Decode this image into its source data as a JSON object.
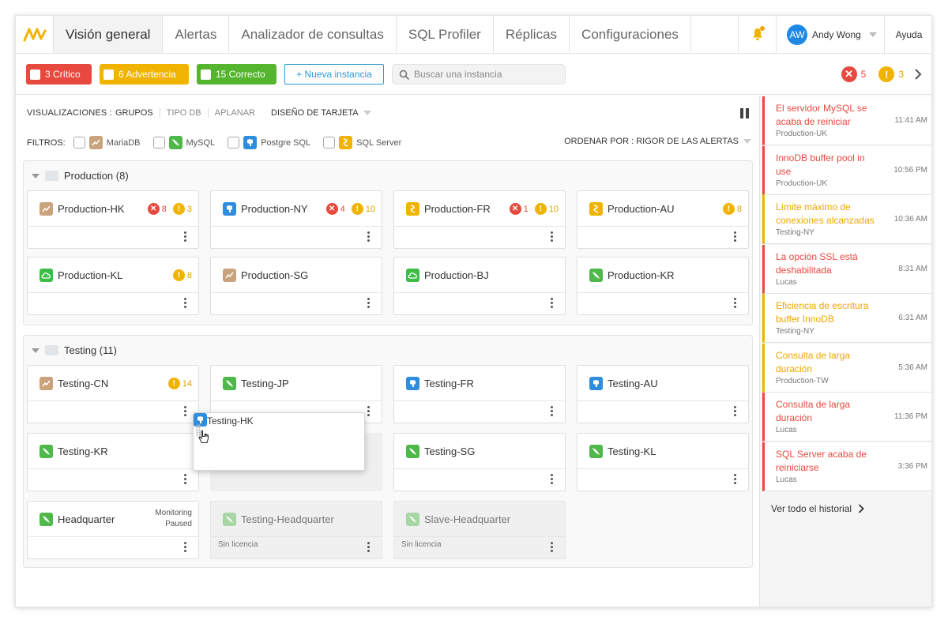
{
  "nav": {
    "tabs": [
      {
        "label": "Visión general"
      },
      {
        "label": "Alertas"
      },
      {
        "label": "Analizador de consultas"
      },
      {
        "label": "SQL Profiler"
      },
      {
        "label": "Réplicas"
      },
      {
        "label": "Configuraciones"
      }
    ],
    "user": {
      "initials": "AW",
      "name": "Andy Wong"
    },
    "help": "Ayuda"
  },
  "toolbar": {
    "critical": "3 Crítico",
    "warning": "6 Advertencia",
    "ok": "15 Correcto",
    "new_instance": "+ Nueva instancia",
    "search_placeholder": "Buscar una instancia",
    "summary_critical": "5",
    "summary_warning": "3"
  },
  "view": {
    "label": "VISUALIZACIONES :",
    "groups": "GRUPOS",
    "dbtype": "TIPO DB",
    "flatten": "APLANAR",
    "design": "DISEÑO DE TARJETA",
    "filters_label": "FILTROS:",
    "filters": [
      "MariaDB",
      "MySQL",
      "Postgre SQL",
      "SQL Server"
    ],
    "sort": "ORDENAR POR : RIGOR DE LAS ALERTAS"
  },
  "groups": [
    {
      "title": "Production (8)",
      "cards": [
        {
          "name": "Production-HK",
          "db": "mariadb",
          "crit": "8",
          "warn": "3"
        },
        {
          "name": "Production-NY",
          "db": "postgre",
          "crit": "4",
          "warn": "10"
        },
        {
          "name": "Production-FR",
          "db": "sqlserver",
          "crit": "1",
          "warn": "10"
        },
        {
          "name": "Production-AU",
          "db": "sqlserver",
          "crit": "",
          "warn": "8"
        },
        {
          "name": "Production-KL",
          "db": "cloud",
          "crit": "",
          "warn": "8"
        },
        {
          "name": "Production-SG",
          "db": "mariadb",
          "crit": "",
          "warn": ""
        },
        {
          "name": "Production-BJ",
          "db": "cloud",
          "crit": "",
          "warn": ""
        },
        {
          "name": "Production-KR",
          "db": "mysql",
          "crit": "",
          "warn": ""
        }
      ]
    },
    {
      "title": "Testing (11)",
      "cards": [
        {
          "name": "Testing-CN",
          "db": "mariadb",
          "crit": "",
          "warn": "14"
        },
        {
          "name": "Testing-JP",
          "db": "mysql"
        },
        {
          "name": "Testing-FR",
          "db": "postgre"
        },
        {
          "name": "Testing-AU",
          "db": "postgre"
        },
        {
          "name": "Testing-KR",
          "db": "mysql"
        },
        {
          "name": "Testing-SG",
          "db": "mysql"
        },
        {
          "name": "Testing-KL",
          "db": "mysql"
        },
        {
          "name": "Headquarter",
          "db": "mysql",
          "paused": "Monitoring Paused"
        },
        {
          "name": "Testing-Headquarter",
          "db": "mysql",
          "foot": "Sin licencia"
        },
        {
          "name": "Slave-Headquarter",
          "db": "mysql",
          "foot": "Sin licencia"
        }
      ],
      "dragging": {
        "name": "Testing-HK",
        "db": "postgre"
      }
    }
  ],
  "alerts": [
    {
      "title": "El servidor MySQL se acaba de reiniciar",
      "source": "Production-UK",
      "time": "11:41 AM",
      "level": "critical"
    },
    {
      "title": "InnoDB buffer pool in use",
      "source": "Production-UK",
      "time": "10:56 PM",
      "level": "critical"
    },
    {
      "title": "Límite máximo de conexiones alcanzadas",
      "source": "Testing-NY",
      "time": "10:36 AM",
      "level": "warning"
    },
    {
      "title": "La opción SSL está deshabilitada",
      "source": "Lucas",
      "time": "8:31 AM",
      "level": "critical"
    },
    {
      "title": "Eficiencia de escritura buffer InnoDB",
      "source": "Testing-NY",
      "time": "6:31 AM",
      "level": "warning"
    },
    {
      "title": "Consulta de larga duración",
      "source": "Production-TW",
      "time": "5:36 AM",
      "level": "warning"
    },
    {
      "title": "Consulta de larga duración",
      "source": "Lucas",
      "time": "11:36 PM",
      "level": "critical"
    },
    {
      "title": "SQL Server acaba de reiniciarse",
      "source": "Lucas",
      "time": "3:36 PM",
      "level": "critical"
    }
  ],
  "history_link": "Ver todo el historial",
  "colors": {
    "critical": "#e8493f",
    "warning": "#f0b400",
    "ok": "#55b52f",
    "accent": "#2d9ad3"
  }
}
